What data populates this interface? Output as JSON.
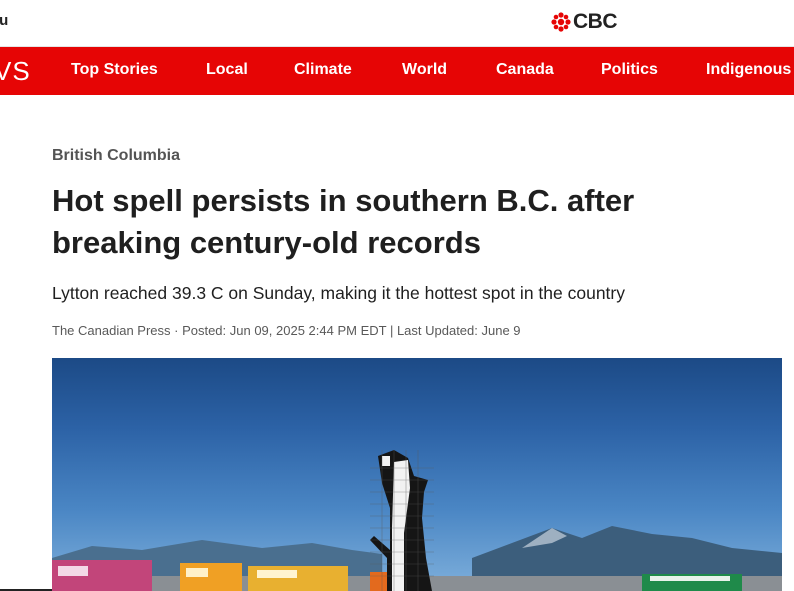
{
  "header": {
    "menu_label": "nu",
    "logo_text": "CBC"
  },
  "nav": {
    "brand": "VS",
    "items": [
      "Top Stories",
      "Local",
      "Climate",
      "World",
      "Canada",
      "Politics",
      "Indigenous"
    ]
  },
  "article": {
    "category": "British Columbia",
    "headline_line1": "Hot spell persists in southern B.C. after",
    "headline_line2": "breaking century-old records",
    "deck": "Lytton reached 39.3 C on Sunday, making it the hottest spot in the country",
    "byline": "The Canadian Press · Posted: Jun 09, 2025 2:44 PM EDT | Last Updated: June 9"
  },
  "colors": {
    "brand_red": "#e60505",
    "text_dark": "#1f1f1f",
    "text_muted": "#595959"
  }
}
